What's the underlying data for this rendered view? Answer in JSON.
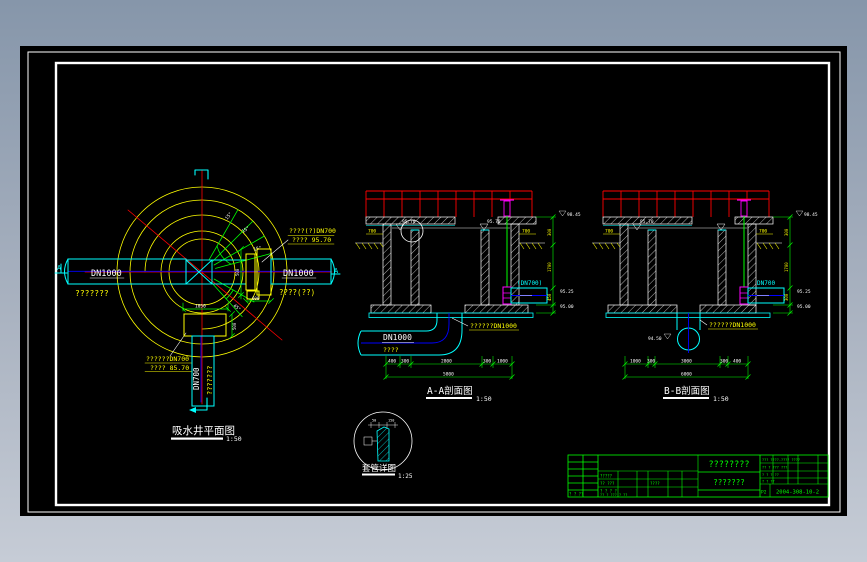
{
  "colors": {
    "bg_top": "#8696aa",
    "bg_bottom": "#c6ccd6",
    "canvas": "#000000",
    "frame": "#ffffff",
    "yellow": "#ffff00",
    "cyan": "#00ffff",
    "red": "#ff0000",
    "green": "#00ff00",
    "magenta": "#ff00ff",
    "blue": "#0000ff"
  },
  "plan": {
    "title": "吸水井平面图",
    "scale": "1:50",
    "pipe_left_label": "DN1000",
    "pipe_left_sub": "???????",
    "pipe_right_label": "DN1000",
    "pipe_right_sub": "????(??)",
    "pipe_bottom_label": "DN700",
    "pipe_bottom_sub": "???????",
    "leader_ne_line1": "????(?)DN700",
    "leader_ne_line2": "???? 95.70",
    "leader_sw_line1": "??????DN700",
    "leader_sw_line2": "???? 85.70",
    "dim_top_box": "1050",
    "dim_box_side": "500",
    "dim_flange_v": "500",
    "dim_flange_h": "600",
    "angles": [
      "15°",
      "15°",
      "15°",
      "45°"
    ],
    "marker_a": "A"
  },
  "section_a": {
    "title": "A-A剖面图",
    "scale": "1:50",
    "pipe_label": "DN1000",
    "pipe_sub": "????",
    "leader_bottom": "??????DN1000",
    "valve_label": "(DN700)",
    "dim_left": "700",
    "dim_right": "700",
    "dims": [
      "400",
      "300",
      "2800",
      "300",
      "1000"
    ],
    "dim_total": "5800",
    "side_dims": [
      "300",
      "1700",
      "450"
    ],
    "elev_top": "98.45",
    "elev_water": "95.70",
    "elev_mid": "95.25",
    "elev_low": "95.00"
  },
  "section_b": {
    "title": "B-B剖面图",
    "scale": "1:50",
    "pipe_label": "DN700",
    "leader_bottom": "??????DN1000",
    "dim_left": "700",
    "dim_right": "700",
    "dims": [
      "1000",
      "300",
      "3000",
      "300",
      "400"
    ],
    "dim_total": "6000",
    "side_dims": [
      "300",
      "1700",
      "300"
    ],
    "elev_top": "98.45",
    "elev_water": "95.70",
    "elev_mid": "95.25",
    "elev_low": "95.00",
    "elev_pipe": "94.50"
  },
  "detail": {
    "title": "套管详图",
    "scale": "1:25",
    "dim1": "50",
    "dim2": "150"
  },
  "titleblock": {
    "project": "????????",
    "drawing_name": "???????",
    "mid_r1": "?????",
    "mid_r2": "?? ???",
    "mid_r3": "? ? ? ?",
    "mid_extra": "????",
    "mid_bottom": "??  ?  ???  ?  ??",
    "left_bottom": "? ? ??",
    "right_r1": "??? ????-???? ????",
    "right_r2": "?? ? ??? ???",
    "right_r3": "? ? ?  ??",
    "right_r4": "?  ?  ??",
    "sheet": "P2",
    "number": "2004-308-10-2"
  }
}
